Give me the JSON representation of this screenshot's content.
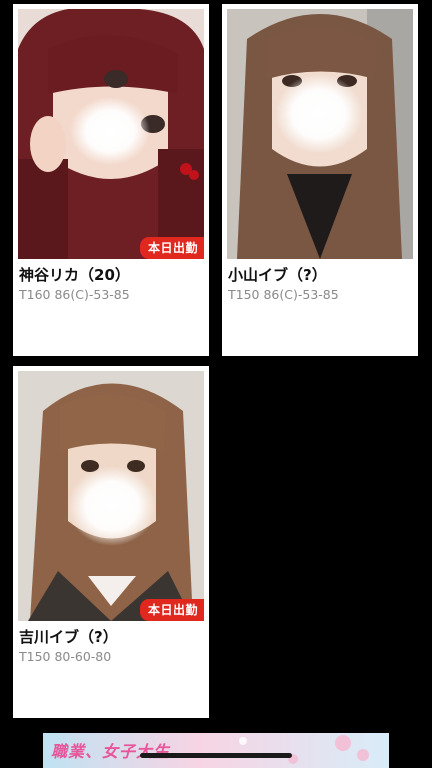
{
  "girls": [
    {
      "name": "神谷リカ（20）",
      "specs": "T160 86(C)-53-85",
      "badge": "本日出勤"
    },
    {
      "name": "小山イブ（?）",
      "specs": "T150 86(C)-53-85",
      "badge": ""
    },
    {
      "name": "吉川イブ（?）",
      "specs": "T150 80-60-80",
      "badge": "本日出勤"
    }
  ],
  "banner": {
    "text": "職業、女子大生"
  },
  "colors": {
    "background": "#000000",
    "card": "#ffffff",
    "badge": "#e0281e",
    "specs_text": "#8a8a8a"
  }
}
